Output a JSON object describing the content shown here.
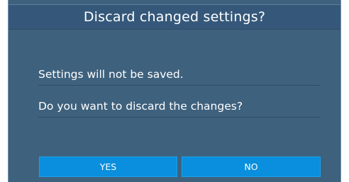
{
  "dialog": {
    "title": "Discard changed settings?",
    "message_line1": "Settings will not be saved.",
    "message_line2": "Do you want to discard the changes?",
    "yes_label": "YES",
    "no_label": "NO"
  },
  "colors": {
    "background": "#3e617d",
    "title_bar": "#35587a",
    "button": "#0a8fde",
    "text": "#ffffff"
  }
}
